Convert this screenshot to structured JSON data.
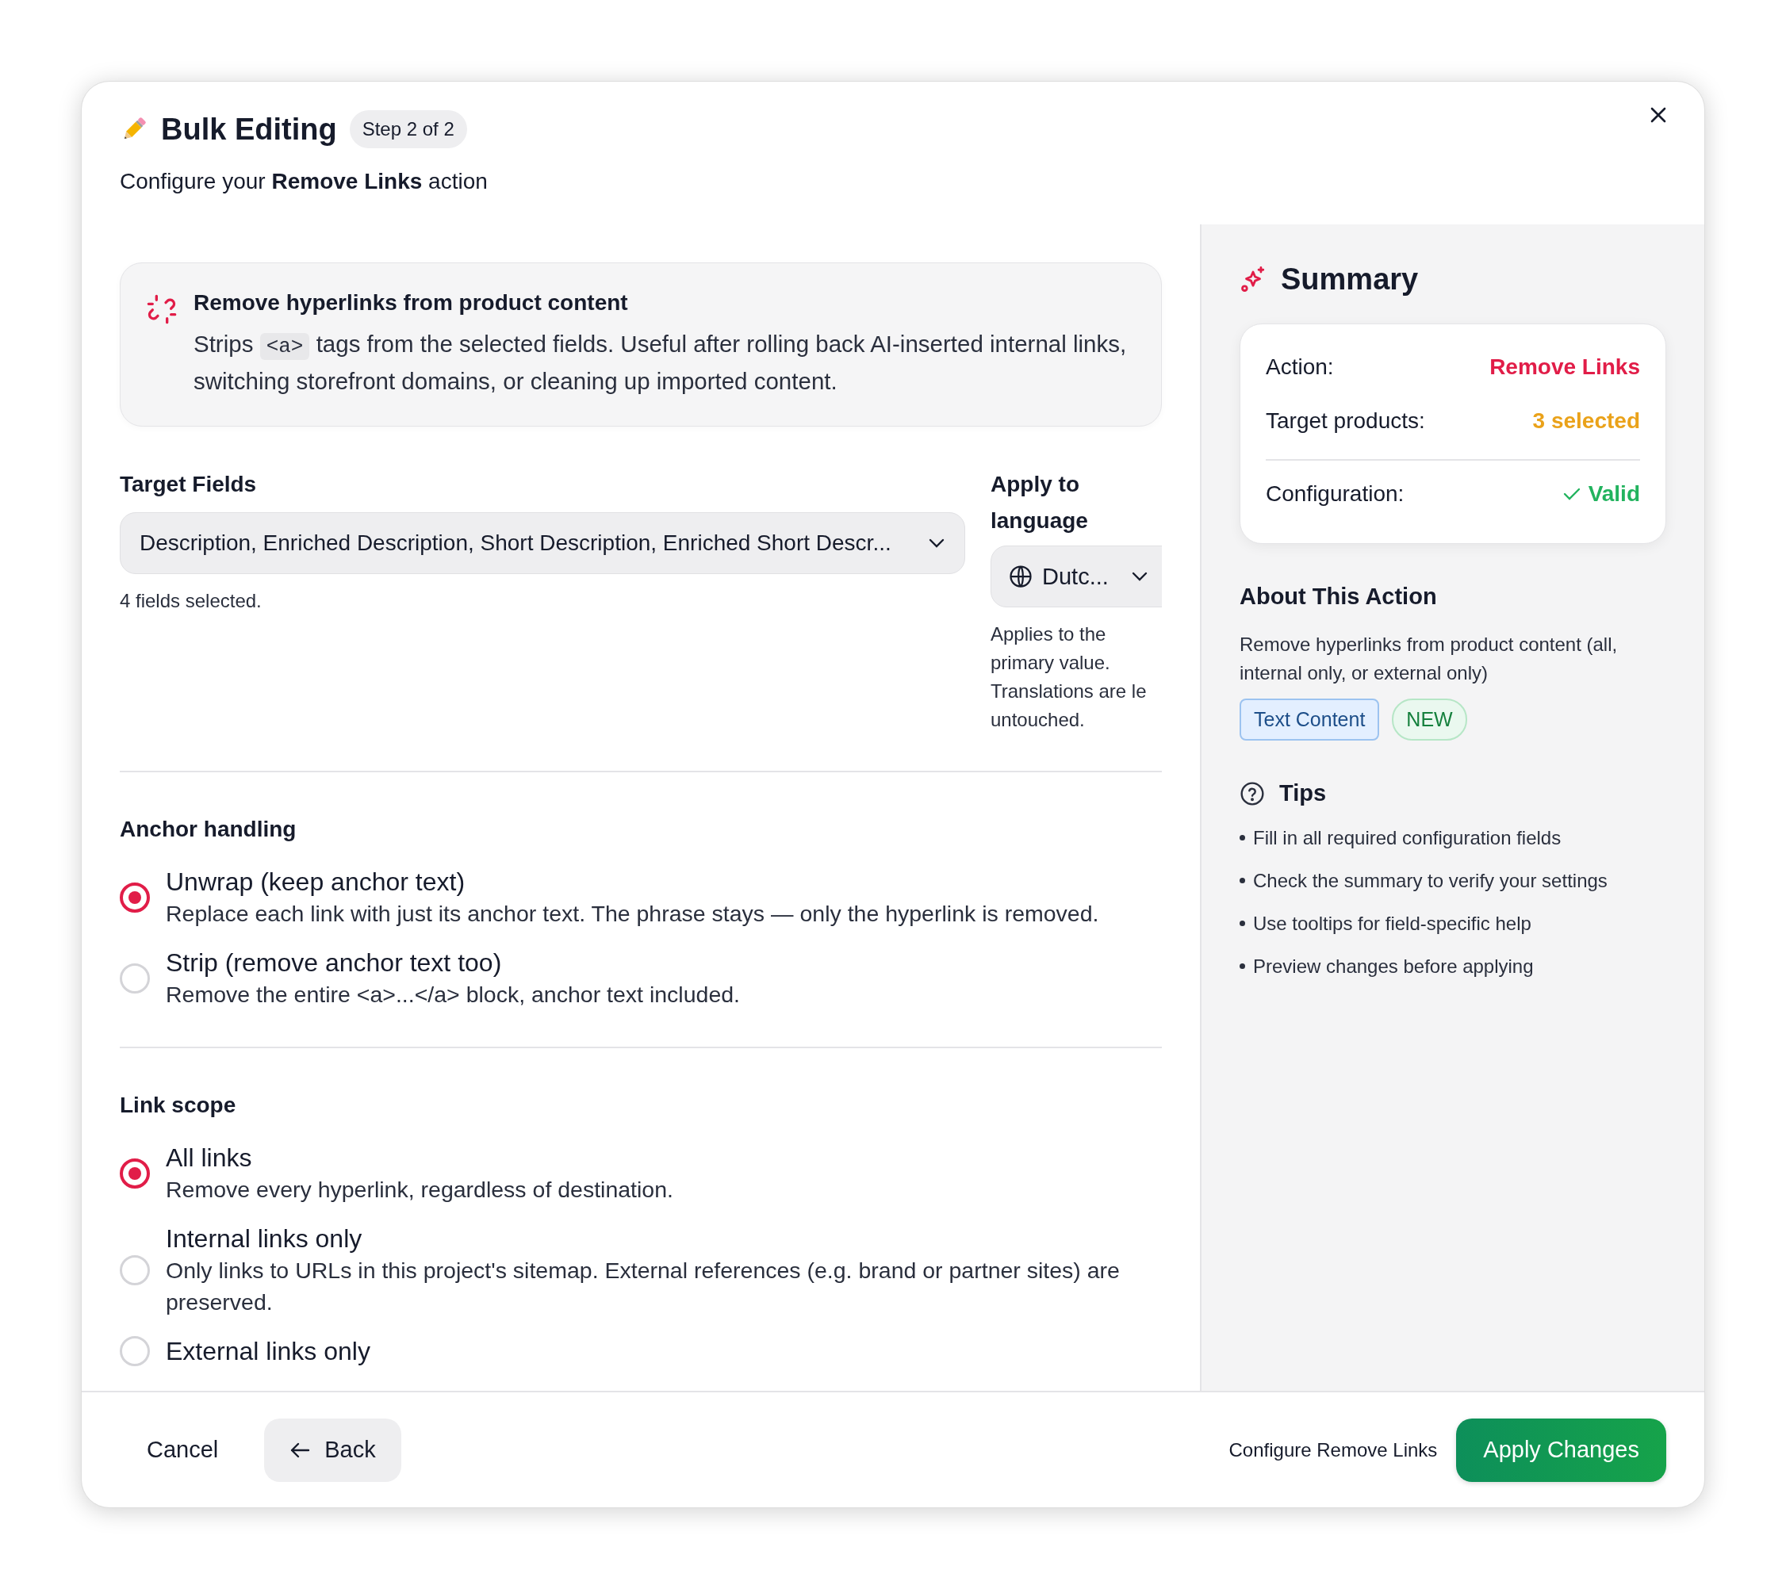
{
  "header": {
    "title": "Bulk Editing",
    "step": "Step 2 of 2",
    "subtitle": "Configure your **Remove Links** action"
  },
  "info": {
    "title": "Remove hyperlinks from product content",
    "text_before": "Strips",
    "code": "<a>",
    "text_after": "tags from the selected fields. Useful after rolling back AI-inserted internal links, switching storefront domains, or cleaning up imported content."
  },
  "target_fields": {
    "label": "Target Fields",
    "value": "Description, Enriched Description, Short Description, Enriched Short Descr...",
    "helper": "4 fields selected."
  },
  "language": {
    "label": "Apply to language",
    "value": "Dutc...",
    "helper_lines": [
      "Applies to the",
      "primary value.",
      "Translations are le",
      "untouched."
    ]
  },
  "option_groups": [
    {
      "label": "Anchor handling",
      "options": [
        {
          "title": "Unwrap (keep anchor text)",
          "description": "Replace each link with just its anchor text. The phrase stays — only the hyperlink is removed.",
          "selected": true
        },
        {
          "title": "Strip (remove anchor text too)",
          "description": "Remove the entire <a>...</a> block, anchor text included.",
          "selected": false
        }
      ]
    },
    {
      "label": "Link scope",
      "options": [
        {
          "title": "All links",
          "description": "Remove every hyperlink, regardless of destination.",
          "selected": true
        },
        {
          "title": "Internal links only",
          "description": "Only links to URLs in this project's sitemap. External references (e.g. brand or partner sites) are preserved.",
          "selected": false
        },
        {
          "title": "External links only",
          "selected": false
        }
      ]
    }
  ],
  "summary": {
    "title": "Summary",
    "rows": [
      {
        "label": "Action:",
        "value": "Remove Links",
        "color": "#e11d48",
        "kind": "text"
      },
      {
        "label": "Target products:",
        "value": "3 selected",
        "color": "#eaa21a",
        "kind": "text"
      },
      {
        "label": "Configuration:",
        "value": "Valid",
        "color": "#22b35e",
        "kind": "check"
      }
    ]
  },
  "about": {
    "title": "About This Action",
    "description": "Remove hyperlinks from product content (all, internal only, or external only)",
    "tags": [
      {
        "label": "Text Content",
        "kind": "category"
      },
      {
        "label": "NEW",
        "kind": "new"
      }
    ]
  },
  "tips": {
    "title": "Tips",
    "items": [
      "Fill in all required configuration fields",
      "Check the summary to verify your settings",
      "Use tooltips for field-specific help",
      "Preview changes before applying"
    ]
  },
  "footer": {
    "cancel": "Cancel",
    "back": "Back",
    "hint": "Configure Remove Links",
    "apply": "Apply Changes"
  }
}
